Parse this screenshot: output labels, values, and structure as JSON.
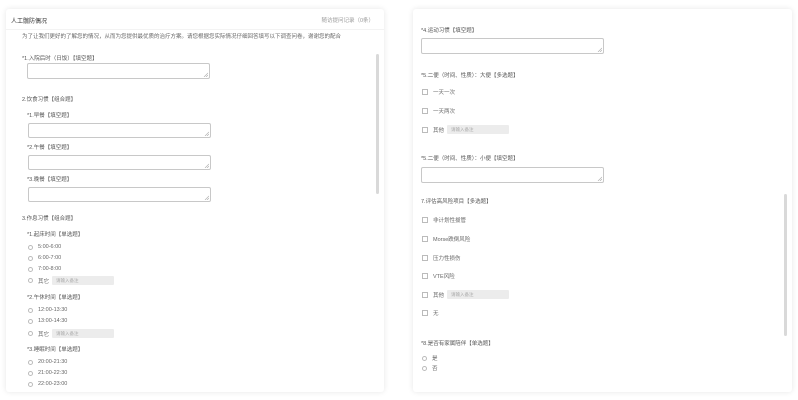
{
  "left_panel": {
    "title": "人工髋防偶况",
    "history": "随访提问记录（0条）",
    "intro": "为了让我们更好的了解您的情况，从而为您提供最优质的治疗方案。请您根据您实际情况仔细回答填写以下调查问卷，谢谢您的配合",
    "q1": {
      "label": "*1.入院后时（日饭）【填空题】"
    },
    "section2": "2.饮食习惯【组合题】",
    "q2_1": "*1.早餐【填空题】",
    "q2_2": "*2.午餐【填空题】",
    "q2_3": "*3.晚餐【填空题】",
    "section3": "3.作息习惯【组合题】",
    "q3_1": {
      "label": "*1.起床时间【单选题】",
      "options": [
        "5:00-6:00",
        "6:00-7:00",
        "7:00-8:00"
      ],
      "other": "其它",
      "other_placeholder": "请输入备注"
    },
    "q3_2": {
      "label": "*2.午休时间【单选题】",
      "options": [
        "12:00-13:30",
        "13:00-14:30"
      ],
      "other": "其它",
      "other_placeholder": "请输入备注"
    },
    "q3_3": {
      "label": "*3.睡眠时间【单选题】",
      "options": [
        "20:00-21:30",
        "21:00-22:30",
        "22:00-23:00"
      ]
    }
  },
  "right_panel": {
    "q4": "*4.运动习惯【填空题】",
    "q5": {
      "label": "*5.二便（时间、性质）：大便【多选题】",
      "options": [
        "一天一次",
        "一天两次"
      ],
      "other": "其他",
      "other_placeholder": "请输入备注"
    },
    "q6": "*5.二便（时间、性质）：小便【填空题】",
    "q7": {
      "label": "7.评估高风险项目【多选题】",
      "options": [
        "非计划性拔管",
        "Morse跌倒风险",
        "压力性损伤",
        "VTE风险"
      ],
      "other": "其他",
      "other_placeholder": "请输入备注",
      "none": "无"
    },
    "q8": {
      "label": "*8.是否有家属陪伴【单选题】",
      "options": [
        "是",
        "否"
      ]
    }
  },
  "colors": {
    "border": "#c8c8c8",
    "text": "#555555",
    "muted": "#999999",
    "input_bg": "#ececec",
    "scrollbar": "#d9d9d9"
  }
}
